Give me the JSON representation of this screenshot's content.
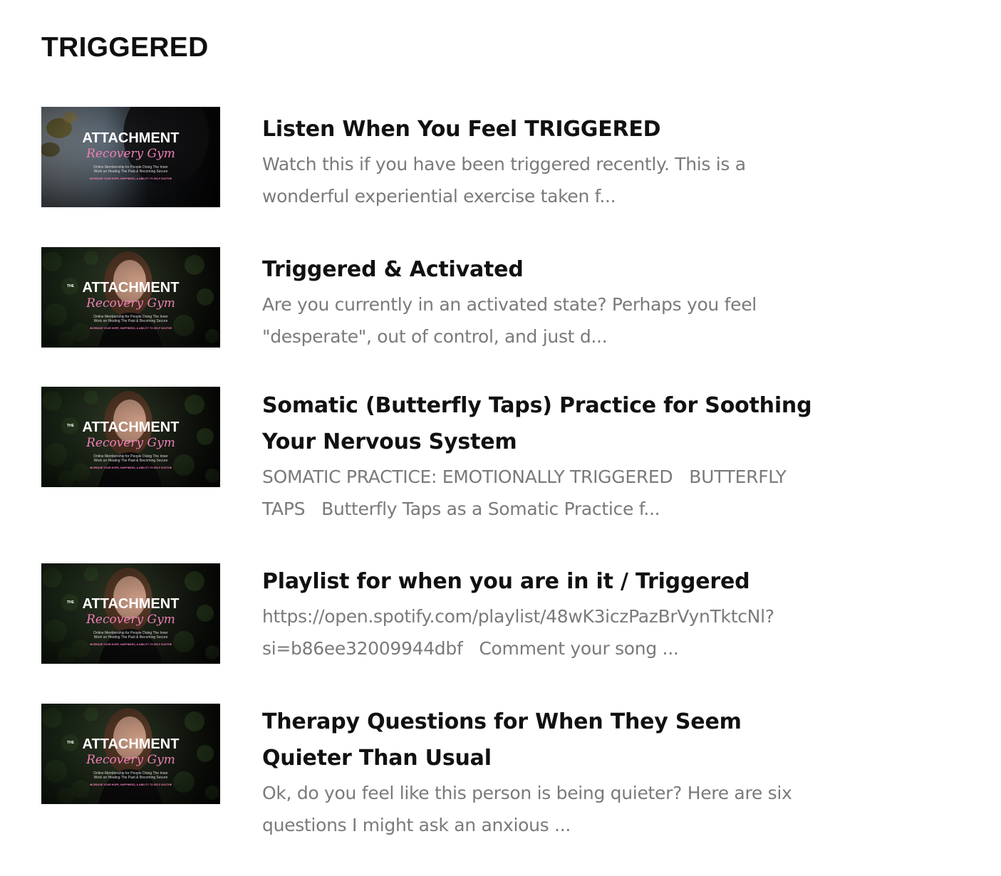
{
  "section": {
    "title": "TRIGGERED"
  },
  "thumbnail": {
    "logo_word": "ATTACHMENT",
    "logo_prefix": "THE",
    "logo_script": "Recovery Gym",
    "tagline_line1": "Online Membership for People Doing The Inner",
    "tagline_line2": "Work on Healing The Past & Becoming Secure",
    "footer": "INCREASE YOUR HOPE, HAPPINESS, & ABILITY TO SELF SOOTHE"
  },
  "lessons": [
    {
      "title": "Listen When You Feel TRIGGERED",
      "description": "Watch this if you have been triggered recently. This is a wonderful experiential exercise taken f...",
      "thumb_variant": "water"
    },
    {
      "title": "Triggered & Activated",
      "description": "Are you currently in an activated state? Perhaps you feel \"desperate\", out of control, and just d...",
      "thumb_variant": "portrait"
    },
    {
      "title": "Somatic (Butterfly Taps) Practice for Soothing Your Nervous System",
      "description": "SOMATIC PRACTICE: EMOTIONALLY TRIGGERED   BUTTERFLY TAPS   Butterfly Taps as a Somatic Practice f...",
      "thumb_variant": "portrait"
    },
    {
      "title": "Playlist for when you are in it / Triggered",
      "description": "https://open.spotify.com/playlist/48wK3iczPazBrVynTktcNl?si=b86ee32009944dbf   Comment your song ...",
      "thumb_variant": "portrait"
    },
    {
      "title": "Therapy Questions for When They Seem Quieter Than Usual",
      "description": "Ok, do you feel like this person is being quieter? Here are six questions I might ask an anxious ...",
      "thumb_variant": "portrait"
    }
  ]
}
